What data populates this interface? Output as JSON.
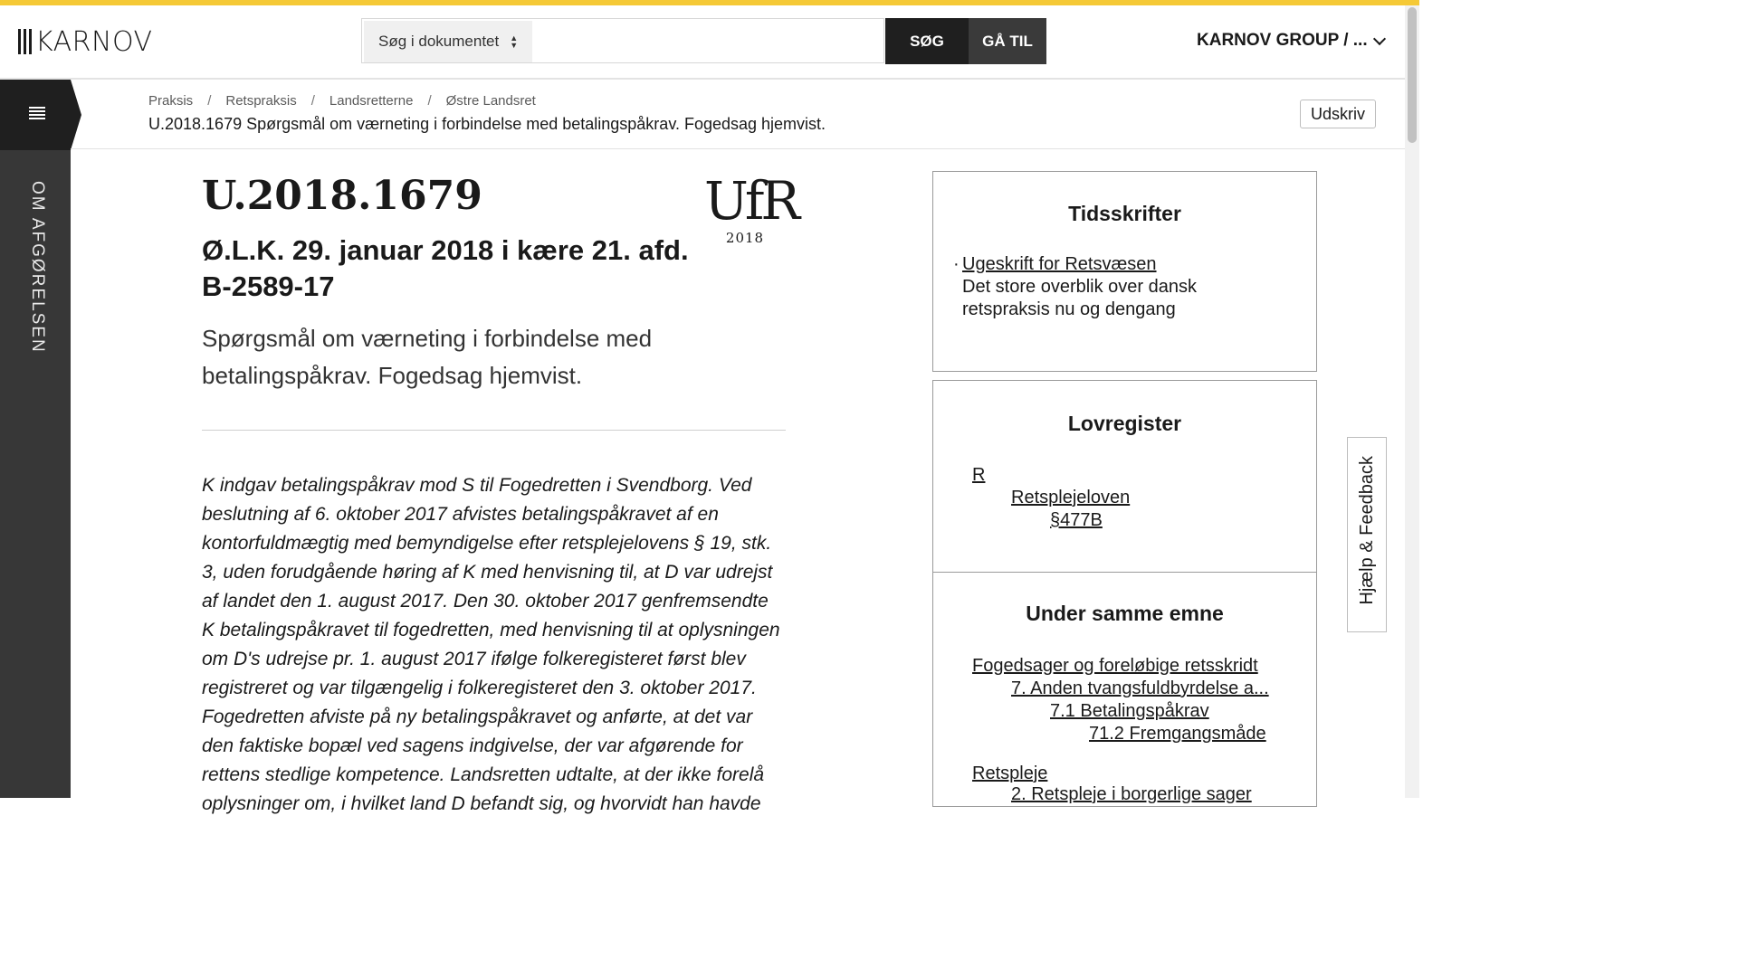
{
  "header": {
    "logo_text": "KARNOV",
    "search_scope": "Søg i dokumentet",
    "search_value": "",
    "search_button": "SØG",
    "goto_button": "GÅ TIL",
    "account_label": "KARNOV GROUP / ..."
  },
  "sidebar": {
    "vertical_label": "OM AFGØRELSEN"
  },
  "breadcrumb": {
    "items": [
      "Praksis",
      "Retspraksis",
      "Landsretterne",
      "Østre Landsret"
    ],
    "separator": "/",
    "doc_title": "U.2018.1679 Spørgsmål om værneting i forbindelse med betalingspåkrav. Fogedsag hjemvist.",
    "print_button": "Udskriv"
  },
  "document": {
    "case_number": "U.2018.1679",
    "court_line1": "Ø.L.K. 29. januar 2018 i kære 21. afd.",
    "court_line2": "B-2589-17",
    "summary": "Spørgsmål om værneting i forbindelse med betalingspåkrav. Fogedsag hjemvist.",
    "ufr_mark": "UfR",
    "ufr_year": "2018",
    "body": "K indgav betalingspåkrav mod S til Fogedretten i Svendborg. Ved beslutning af 6. oktober 2017 afvistes betalingspåkravet af en kontorfuldmægtig med bemyndigelse efter retsplejelovens § 19, stk. 3, uden forudgående høring af K med henvisning til, at D var udrejst af landet den 1. august 2017. Den 30. oktober 2017 genfremsendte K betalingspåkravet til fogedretten, med henvisning til at oplysningen om D's udrejse pr. 1. august 2017 ifølge folkeregisteret først blev registreret og var tilgængelig i folkeregisteret den 3. oktober 2017. Fogedretten afviste på ny betalingspåkravet og anførte, at det var den faktiske bopæl ved sagens indgivelse, der var afgørende for rettens stedlige kompetence. Landsretten udtalte, at der ikke forelå oplysninger om, i hvilket land D befandt sig, og hvorvidt han havde"
  },
  "panels": {
    "tidsskrifter": {
      "title": "Tidsskrifter",
      "link": "Ugeskrift for Retsvæsen",
      "description": "Det store overblik over dansk retspraksis nu og dengang"
    },
    "lovregister": {
      "title": "Lovregister",
      "letter": "R",
      "law": "Retsplejeloven",
      "section": "§477B"
    },
    "samme_emne": {
      "title": "Under samme emne",
      "items": [
        "Fogedsager og foreløbige retsskridt",
        "7. Anden tvangsfuldbyrdelse a...",
        "7.1 Betalingspåkrav",
        "71.2 Fremgangsmåde",
        "Retspleje",
        "2. Retspleje i borgerlige sager"
      ]
    }
  },
  "feedback_label": "Hjælp & Feedback",
  "colors": {
    "accent_stripe": "#f5c936",
    "sidebar": "#373737",
    "dark_button": "#1f1f1f"
  },
  "icons": [
    "menu-list-icon",
    "sort-arrows-icon",
    "chevron-down-icon"
  ]
}
